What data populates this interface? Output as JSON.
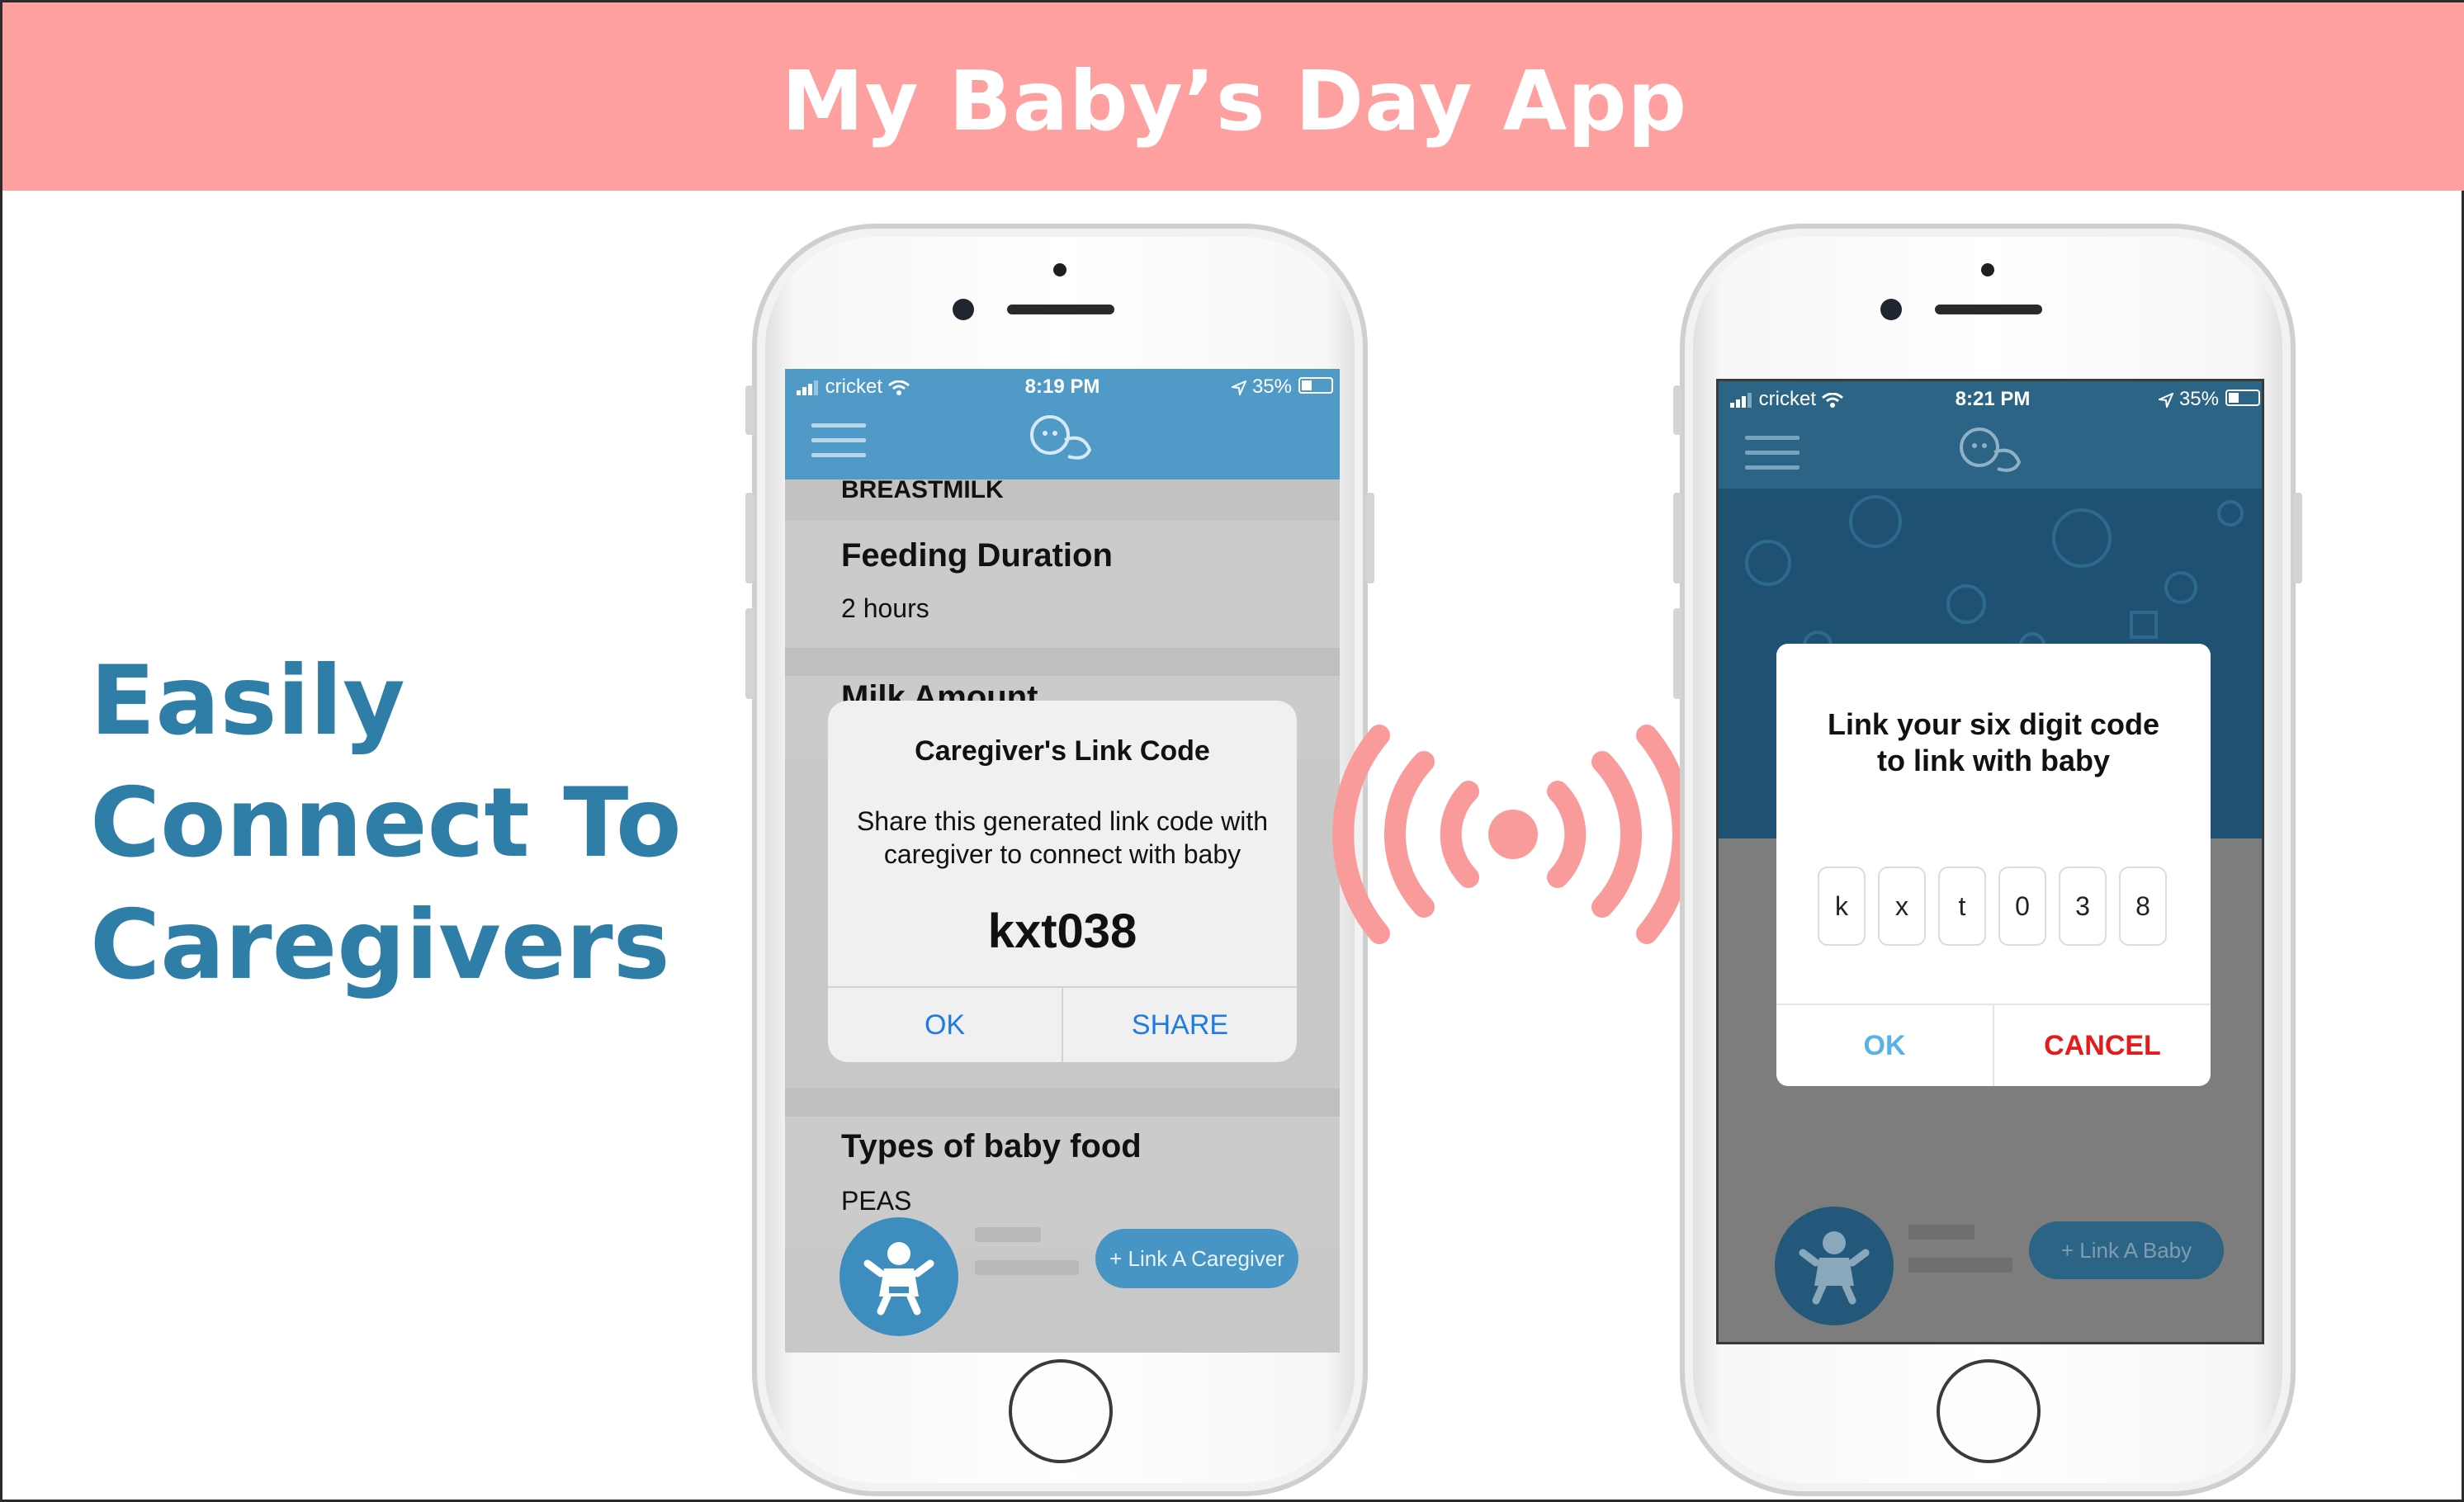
{
  "banner": {
    "title": "My Baby’s Day App"
  },
  "tagline": {
    "lines": [
      "Easily",
      "Connect To",
      "Caregivers"
    ]
  },
  "colors": {
    "banner": "#fea0a0",
    "accent": "#2f7ea8",
    "app_blue": "#4f9ac7",
    "signal": "#f99b9b",
    "ok_blue": "#1e7be0",
    "cancel_red": "#e51b1b"
  },
  "phone_left": {
    "status": {
      "carrier": "cricket",
      "time": "8:19 PM",
      "battery": "35%"
    },
    "sections": [
      {
        "value": "BREASTMILK"
      },
      {
        "label": "Feeding Duration",
        "value": "2 hours"
      },
      {
        "label": "Milk Amount"
      },
      {
        "label": "Types of baby food",
        "value": "PEAS"
      }
    ],
    "dialog": {
      "title": "Caregiver's Link Code",
      "message": "Share this generated link code with caregiver to connect with baby",
      "code": "kxt038",
      "ok_label": "OK",
      "share_label": "SHARE"
    },
    "link_button": "+ Link A Caregiver"
  },
  "phone_right": {
    "status": {
      "carrier": "cricket",
      "time": "8:21 PM",
      "battery": "35%"
    },
    "dialog": {
      "message": "Link your six digit code to link with baby",
      "digits": [
        "k",
        "x",
        "t",
        "0",
        "3",
        "8"
      ],
      "ok_label": "OK",
      "cancel_label": "CANCEL"
    },
    "link_button": "+ Link A Baby"
  },
  "icons": [
    "menu-icon",
    "baby-logo-icon",
    "wifi-icon",
    "signal-bars-icon",
    "location-arrow-icon",
    "battery-icon",
    "baby-avatar-icon",
    "broadcast-signal-icon"
  ]
}
